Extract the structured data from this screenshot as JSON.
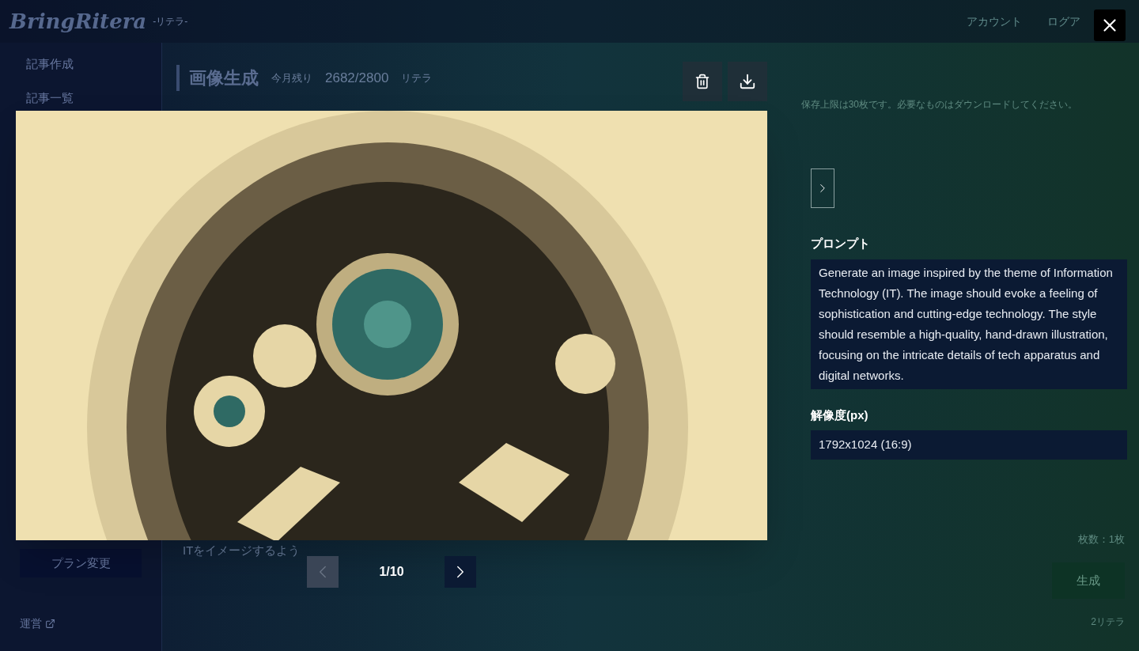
{
  "header": {
    "logo": "BringRitera",
    "logo_sub": "-リテラ-",
    "menu": [
      {
        "label": "アカウント"
      },
      {
        "label": "ログア"
      }
    ]
  },
  "sidebar": {
    "items": [
      {
        "label": "記事作成"
      },
      {
        "label": "記事一覧"
      }
    ],
    "plan_button": "プラン変更",
    "footer_link": "運営"
  },
  "main": {
    "title": "画像生成",
    "remaining_label": "今月残り",
    "remaining": "2682/2800",
    "remaining_unit": "リテラ",
    "note": "保存上限は30枚です。必要なものはダウンロードしてください。",
    "prompt_input": "ITをイメージするよう",
    "count": "枚数：1枚",
    "generate_button": "生成",
    "cost": "2リテラ"
  },
  "viewer": {
    "page": "1/10",
    "prev_disabled": true,
    "next_disabled": false,
    "prompt_label": "プロンプト",
    "prompt": "Generate an image inspired by the theme of Information Technology (IT). The image should evoke a feeling of sophistication and cutting-edge technology. The style should resemble a high-quality, hand-drawn illustration, focusing on the intricate details of tech apparatus and digital networks.",
    "resolution_label": "解像度(px)",
    "resolution": "1792x1024 (16:9)"
  }
}
